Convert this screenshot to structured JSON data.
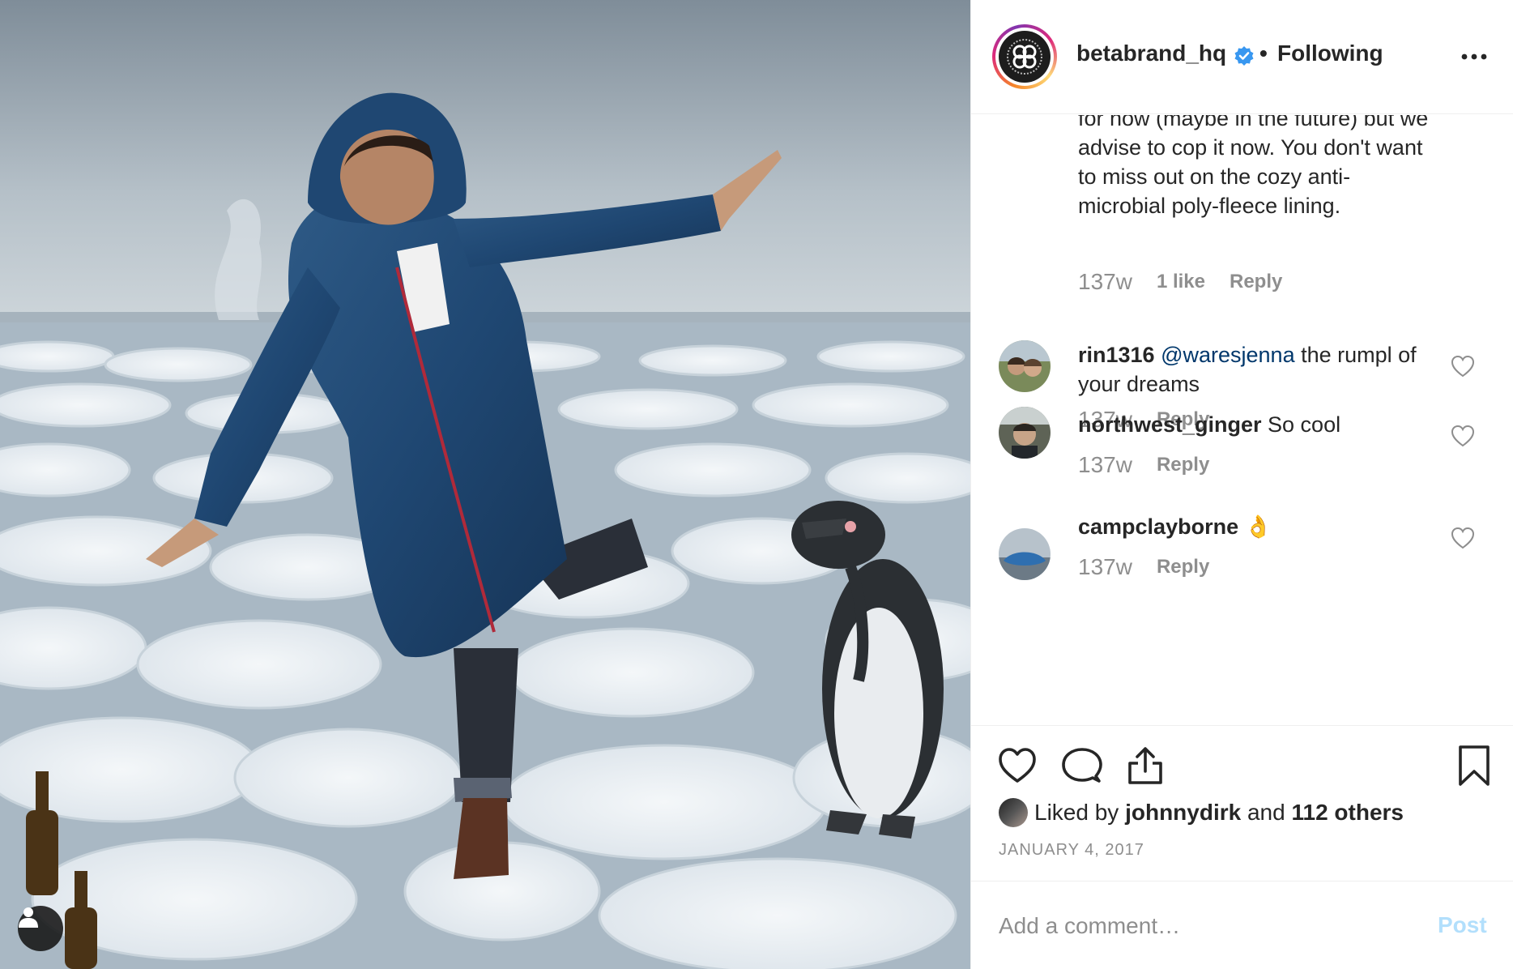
{
  "post": {
    "image_alt": "Man in a blue quilted hooded coat balancing on ice floes next to a penguin",
    "tag_button_icon": "user-icon"
  },
  "header": {
    "username": "betabrand_hq",
    "separator": "•",
    "follow_status": "Following",
    "more_icon": "more-horizontal-icon",
    "verified_icon": "verified-badge-icon"
  },
  "caption": {
    "continued_text": "for now (maybe in the future) but we advise to cop it now. You don't want to miss out on the cozy anti-microbial poly-fleece lining.",
    "time": "137w",
    "likes": "1 like",
    "reply": "Reply"
  },
  "comments": [
    {
      "username": "rin1316",
      "mention": "@waresjenna",
      "text": " the rumpl of your dreams",
      "time": "137w",
      "reply": "Reply"
    },
    {
      "username": "northwest_ginger",
      "mention": "",
      "text": " So cool",
      "time": "137w",
      "reply": "Reply"
    },
    {
      "username": "campclayborne",
      "mention": "",
      "text": " 👌",
      "time": "137w",
      "reply": "Reply"
    }
  ],
  "actions": {
    "like_icon": "heart-icon",
    "comment_icon": "comment-icon",
    "share_icon": "share-icon",
    "save_icon": "bookmark-icon"
  },
  "likes": {
    "prefix": "Liked by ",
    "user": "johnnydirk",
    "middle": " and ",
    "others": "112 others"
  },
  "date": "JANUARY 4, 2017",
  "add_comment": {
    "placeholder": "Add a comment…",
    "post_label": "Post"
  },
  "colors": {
    "text": "#262626",
    "muted": "#8e8e8e",
    "mention": "#00376b",
    "verified": "#3897f0",
    "post_disabled": "#b2dffc",
    "border": "#efefef"
  }
}
